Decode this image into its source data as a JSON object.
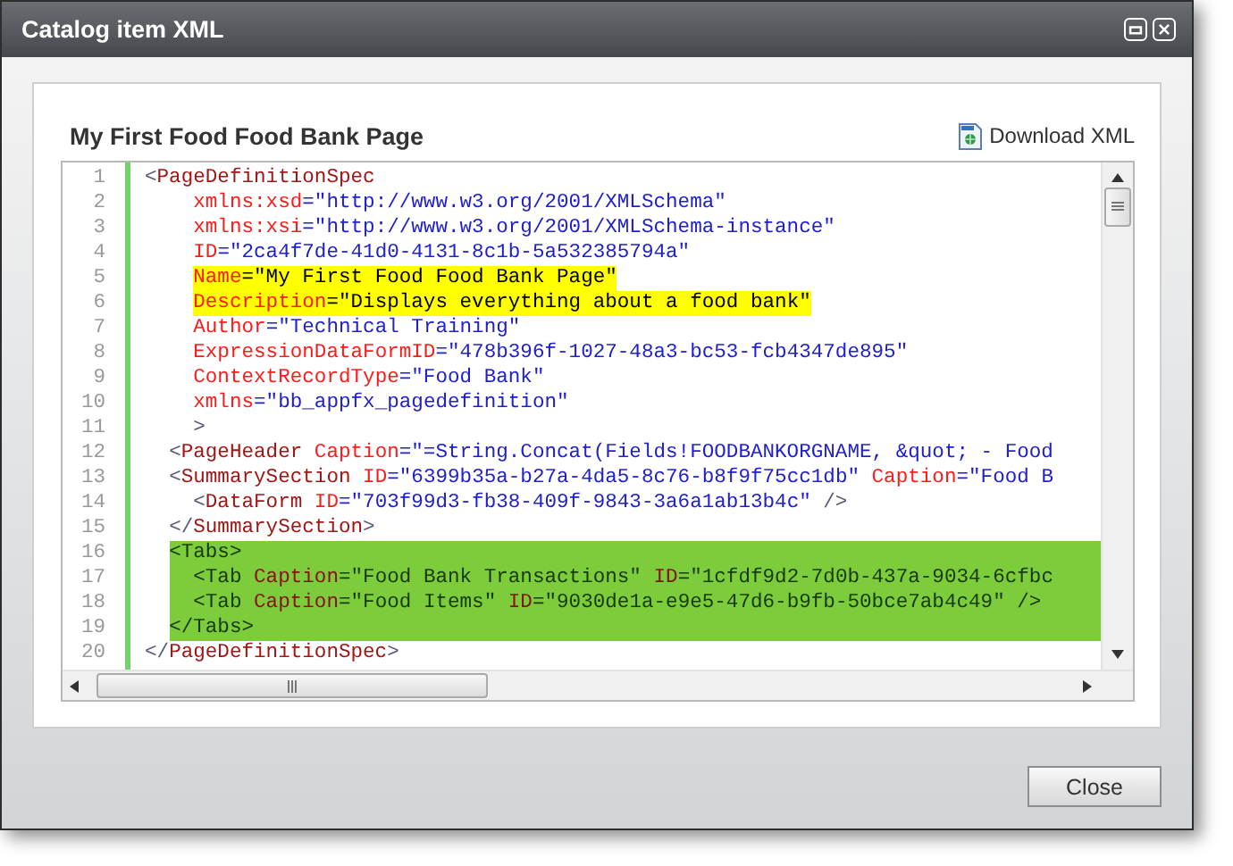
{
  "window": {
    "title": "Catalog item XML"
  },
  "panel": {
    "title": "My First Food Food Bank Page",
    "download_link": "Download XML"
  },
  "editor": {
    "lines": [
      {
        "number": "1",
        "kind": "plain",
        "tokens": [
          {
            "kind": "punct",
            "text": "<"
          },
          {
            "kind": "tag",
            "text": "PageDefinitionSpec"
          }
        ]
      },
      {
        "number": "2",
        "kind": "plain",
        "tokens": [
          {
            "kind": "attr",
            "text": "    xmlns:xsd"
          },
          {
            "kind": "value",
            "text": "=\"http://www.w3.org/2001/XMLSchema\""
          }
        ]
      },
      {
        "number": "3",
        "kind": "plain",
        "tokens": [
          {
            "kind": "attr",
            "text": "    xmlns:xsi"
          },
          {
            "kind": "value",
            "text": "=\"http://www.w3.org/2001/XMLSchema-instance\""
          }
        ]
      },
      {
        "number": "4",
        "kind": "plain",
        "tokens": [
          {
            "kind": "attr",
            "text": "    ID"
          },
          {
            "kind": "value",
            "text": "=\"2ca4f7de-41d0-4131-8c1b-5a532385794a\""
          }
        ]
      },
      {
        "number": "5",
        "kind": "marked",
        "color": "#ffff00",
        "tokens": [
          {
            "kind": "attr",
            "text": "    Name"
          },
          {
            "kind": "value",
            "text": "=\"My First Food Food Bank Page\""
          }
        ]
      },
      {
        "number": "6",
        "kind": "marked",
        "color": "#ffff00",
        "tokens": [
          {
            "kind": "attr",
            "text": "    Description"
          },
          {
            "kind": "value",
            "text": "=\"Displays everything about a food bank\""
          }
        ]
      },
      {
        "number": "7",
        "kind": "plain",
        "tokens": [
          {
            "kind": "attr",
            "text": "    Author"
          },
          {
            "kind": "value",
            "text": "=\"Technical Training\""
          }
        ]
      },
      {
        "number": "8",
        "kind": "plain",
        "tokens": [
          {
            "kind": "attr",
            "text": "    ExpressionDataFormID"
          },
          {
            "kind": "value",
            "text": "=\"478b396f-1027-48a3-bc53-fcb4347de895\""
          }
        ]
      },
      {
        "number": "9",
        "kind": "plain",
        "tokens": [
          {
            "kind": "attr",
            "text": "    ContextRecordType"
          },
          {
            "kind": "value",
            "text": "=\"Food Bank\""
          }
        ]
      },
      {
        "number": "10",
        "kind": "plain",
        "tokens": [
          {
            "kind": "attr",
            "text": "    xmlns"
          },
          {
            "kind": "value",
            "text": "=\"bb_appfx_pagedefinition\""
          }
        ]
      },
      {
        "number": "11",
        "kind": "plain",
        "tokens": [
          {
            "kind": "punct",
            "text": "    >"
          }
        ]
      },
      {
        "number": "12",
        "kind": "plain",
        "tokens": [
          {
            "kind": "punct",
            "text": "  <"
          },
          {
            "kind": "tag",
            "text": "PageHeader"
          },
          {
            "kind": "attr",
            "text": " Caption"
          },
          {
            "kind": "value",
            "text": "=\"=String.Concat(Fields!FOODBANKORGNAME, &quot; - Food"
          }
        ]
      },
      {
        "number": "13",
        "kind": "plain",
        "tokens": [
          {
            "kind": "punct",
            "text": "  <"
          },
          {
            "kind": "tag",
            "text": "SummarySection"
          },
          {
            "kind": "attr",
            "text": " ID"
          },
          {
            "kind": "value",
            "text": "=\"6399b35a-b27a-4da5-8c76-b8f9f75cc1db\""
          },
          {
            "kind": "attr",
            "text": " Caption"
          },
          {
            "kind": "value",
            "text": "=\"Food B"
          }
        ]
      },
      {
        "number": "14",
        "kind": "plain",
        "tokens": [
          {
            "kind": "punct",
            "text": "    <"
          },
          {
            "kind": "tag",
            "text": "DataForm"
          },
          {
            "kind": "attr",
            "text": " ID"
          },
          {
            "kind": "value",
            "text": "=\"703f99d3-fb38-409f-9843-3a6a1ab13b4c\""
          },
          {
            "kind": "punct",
            "text": " />"
          }
        ]
      },
      {
        "number": "15",
        "kind": "plain",
        "tokens": [
          {
            "kind": "punct",
            "text": "  </"
          },
          {
            "kind": "tag",
            "text": "SummarySection"
          },
          {
            "kind": "punct",
            "text": ">"
          }
        ]
      },
      {
        "number": "16",
        "kind": "block",
        "color": "#7dcc3c",
        "tokens": [
          {
            "kind": "punct",
            "text": "  <"
          },
          {
            "kind": "tag",
            "text": "Tabs"
          },
          {
            "kind": "punct",
            "text": ">"
          }
        ]
      },
      {
        "number": "17",
        "kind": "block",
        "color": "#7dcc3c",
        "tokens": [
          {
            "kind": "punct",
            "text": "    <"
          },
          {
            "kind": "tag",
            "text": "Tab"
          },
          {
            "kind": "attr",
            "text": " Caption"
          },
          {
            "kind": "value",
            "text": "=\"Food Bank Transactions\""
          },
          {
            "kind": "attr",
            "text": " ID"
          },
          {
            "kind": "value",
            "text": "=\"1cfdf9d2-7d0b-437a-9034-6cfbc"
          }
        ]
      },
      {
        "number": "18",
        "kind": "block",
        "color": "#7dcc3c",
        "tokens": [
          {
            "kind": "punct",
            "text": "    <"
          },
          {
            "kind": "tag",
            "text": "Tab"
          },
          {
            "kind": "attr",
            "text": " Caption"
          },
          {
            "kind": "value",
            "text": "=\"Food Items\""
          },
          {
            "kind": "attr",
            "text": " ID"
          },
          {
            "kind": "value",
            "text": "=\"9030de1a-e9e5-47d6-b9fb-50bce7ab4c49\""
          },
          {
            "kind": "punct",
            "text": " />"
          }
        ]
      },
      {
        "number": "19",
        "kind": "block",
        "color": "#7dcc3c",
        "tokens": [
          {
            "kind": "punct",
            "text": "  </"
          },
          {
            "kind": "tag",
            "text": "Tabs"
          },
          {
            "kind": "punct",
            "text": ">"
          }
        ]
      },
      {
        "number": "20",
        "kind": "plain",
        "tokens": [
          {
            "kind": "punct",
            "text": "</"
          },
          {
            "kind": "tag",
            "text": "PageDefinitionSpec"
          },
          {
            "kind": "punct",
            "text": ">"
          }
        ]
      }
    ]
  },
  "buttons": [
    {
      "label": "Close"
    }
  ]
}
